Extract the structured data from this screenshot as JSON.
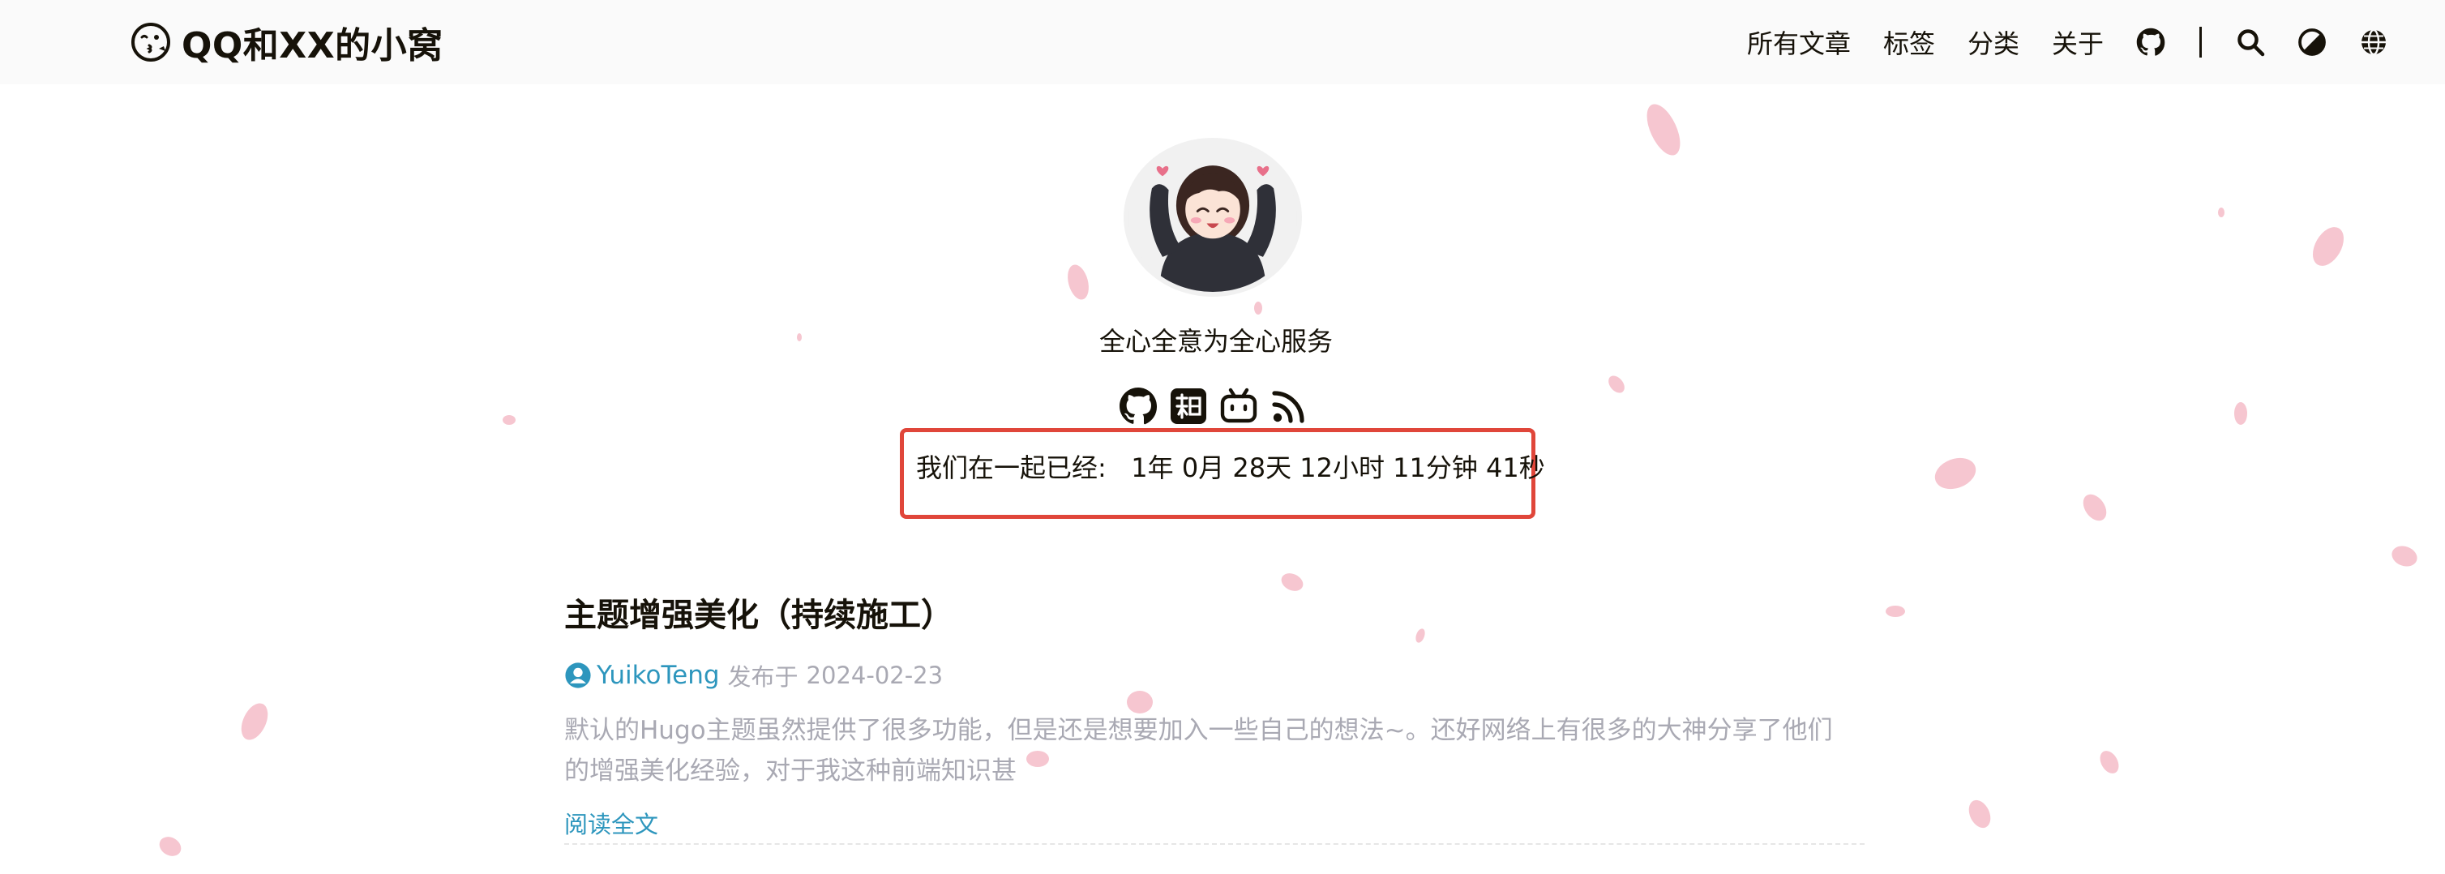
{
  "site": {
    "title": "QQ和XX的小窝",
    "logo_icon": "kissing-face-icon"
  },
  "nav": {
    "items": [
      {
        "label": "所有文章"
      },
      {
        "label": "标签"
      },
      {
        "label": "分类"
      },
      {
        "label": "关于"
      }
    ],
    "icons": [
      "github-icon",
      "search-icon",
      "theme-toggle-icon",
      "language-globe-icon"
    ]
  },
  "profile": {
    "avatar": "anime-girl-avatar",
    "subtitle": "全心全意为全心服务",
    "social": [
      "github-icon",
      "zhihu-icon",
      "bilibili-icon",
      "rss-icon"
    ]
  },
  "counter": {
    "text": "我们在一起已经:   1年 0月 28天 12小时 11分钟 41秒"
  },
  "post": {
    "title": "主题增强美化（持续施工）",
    "author": "YuikoTeng",
    "published_label": "发布于",
    "date": "2024-02-23",
    "summary": "默认的Hugo主题虽然提供了很多功能，但是还是想要加入一些自己的想法~。还好网络上有很多的大神分享了他们的增强美化经验，对于我这种前端知识甚",
    "read_more": "阅读全文"
  },
  "colors": {
    "accent": "#2d96bd",
    "highlight_border": "#e0463a",
    "header_bg": "#fafafa",
    "petal": "#f6c6d0"
  }
}
